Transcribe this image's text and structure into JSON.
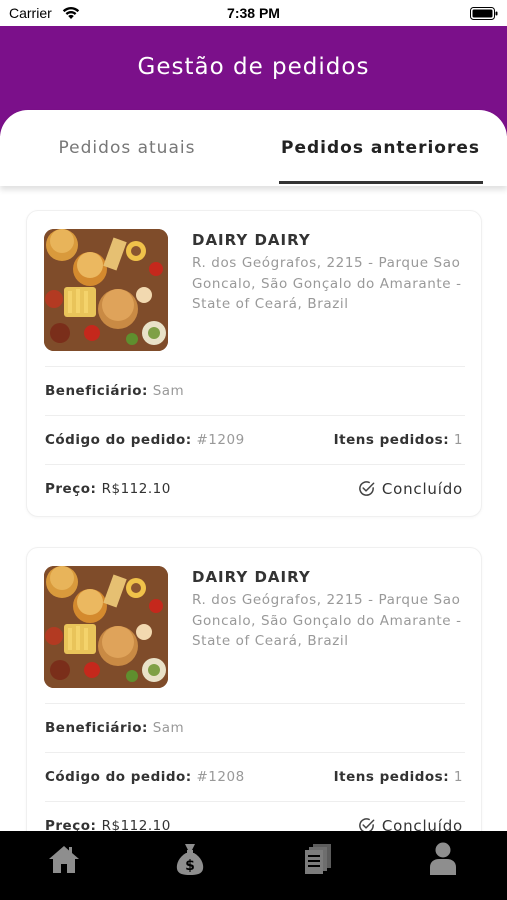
{
  "status_bar": {
    "carrier": "Carrier",
    "time": "7:38 PM"
  },
  "header": {
    "title": "Gestão de pedidos"
  },
  "tabs": [
    {
      "label": "Pedidos atuais",
      "active": false
    },
    {
      "label": "Pedidos anteriores",
      "active": true
    }
  ],
  "orders": [
    {
      "store_name": "DAIRY DAIRY",
      "address": "R. dos Geógrafos, 2215 - Parque Sao Goncalo, São Gonçalo do Amarante - State of Ceará, Brazil",
      "beneficiary_label": "Beneficiário:",
      "beneficiary": "Sam",
      "order_code_label": "Código do pedido:",
      "order_code": "#1209",
      "items_label": "Itens pedidos:",
      "items_count": "1",
      "price_label": "Preço:",
      "price": "R$112.10",
      "status": "Concluído"
    },
    {
      "store_name": "DAIRY DAIRY",
      "address": "R. dos Geógrafos, 2215 - Parque Sao Goncalo, São Gonçalo do Amarante - State of Ceará, Brazil",
      "beneficiary_label": "Beneficiário:",
      "beneficiary": "Sam",
      "order_code_label": "Código do pedido:",
      "order_code": "#1208",
      "items_label": "Itens pedidos:",
      "items_count": "1",
      "price_label": "Preço:",
      "price": "R$112.10",
      "status": "Concluído"
    }
  ],
  "bottom_nav": [
    {
      "icon": "home-icon"
    },
    {
      "icon": "money-bag-icon"
    },
    {
      "icon": "receipts-icon"
    },
    {
      "icon": "user-icon"
    }
  ],
  "colors": {
    "header": "#7b108a",
    "nav_bg": "#000000",
    "nav_icon": "#8e8e8e"
  }
}
